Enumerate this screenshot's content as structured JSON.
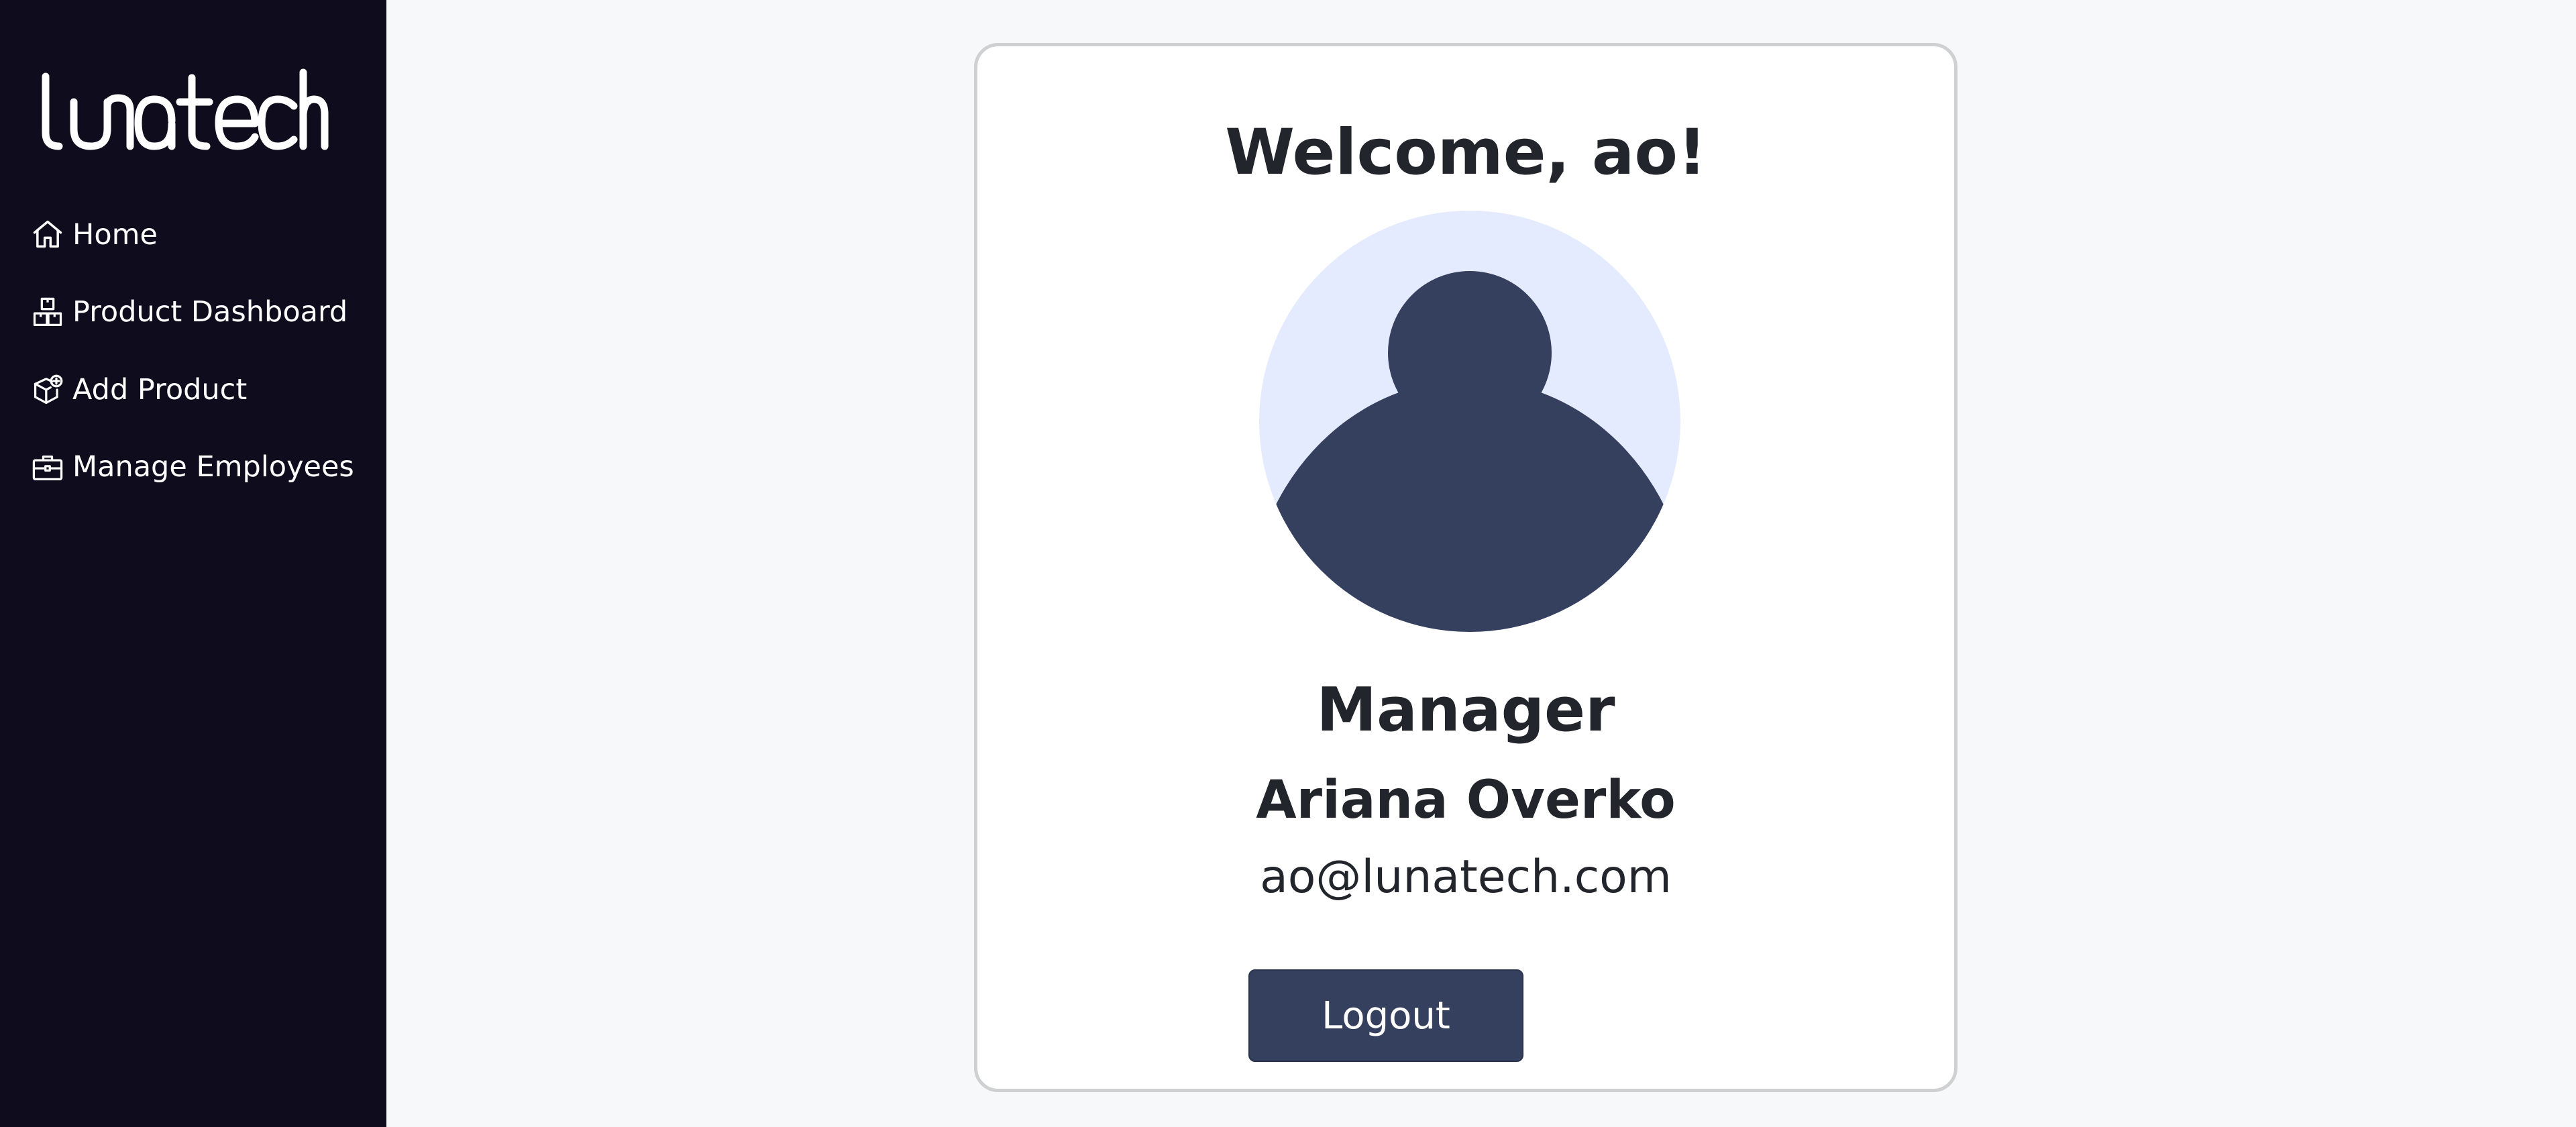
{
  "sidebar": {
    "logo_text": "lunatech",
    "items": [
      {
        "label": "Home",
        "icon": "home-icon"
      },
      {
        "label": "Product Dashboard",
        "icon": "boxes-icon"
      },
      {
        "label": "Add Product",
        "icon": "box-add-icon"
      },
      {
        "label": "Manage Employees",
        "icon": "briefcase-icon"
      }
    ]
  },
  "profile": {
    "welcome": "Welcome, ao!",
    "role": "Manager",
    "name": "Ariana Overko",
    "email": "ao@lunatech.com",
    "logout_label": "Logout"
  },
  "colors": {
    "sidebar_bg": "#0f0d1d",
    "page_bg": "#f7f8fa",
    "accent": "#353f5e",
    "avatar_bg": "#e5ebfe",
    "text": "#22252b"
  }
}
